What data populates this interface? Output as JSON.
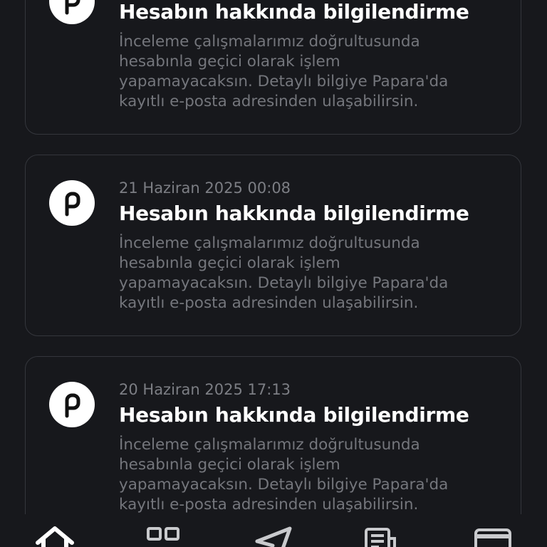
{
  "notifications": [
    {
      "date": "",
      "title": "Hesabın hakkında bilgilendirme",
      "body_lines": [
        "İnceleme çalışmalarımız doğrultusunda",
        "hesabınla geçici olarak işlem",
        "yapamayacaksın. Detaylı bilgiye Papara'da",
        "kayıtlı e-posta adresinden ulaşabilirsin."
      ],
      "icon": "papara-logo-icon"
    },
    {
      "date": "21 Haziran 2025 00:08",
      "title": "Hesabın hakkında bilgilendirme",
      "body_lines": [
        "İnceleme çalışmalarımız doğrultusunda",
        "hesabınla geçici olarak işlem",
        "yapamayacaksın. Detaylı bilgiye Papara'da",
        "kayıtlı e-posta adresinden ulaşabilirsin."
      ],
      "icon": "papara-logo-icon"
    },
    {
      "date": "20 Haziran 2025 17:13",
      "title": "Hesabın hakkında bilgilendirme",
      "body_lines": [
        "İnceleme çalışmalarımız doğrultusunda",
        "hesabınla geçici olarak işlem",
        "yapamayacaksın. Detaylı bilgiye Papara'da",
        "kayıtlı e-posta adresinden ulaşabilirsin."
      ],
      "icon": "papara-logo-icon"
    }
  ],
  "tab_bar": {
    "tabs": [
      {
        "icon": "home-icon"
      },
      {
        "icon": "grid-icon"
      },
      {
        "icon": "send-icon"
      },
      {
        "icon": "document-icon"
      },
      {
        "icon": "card-icon"
      }
    ]
  },
  "colors": {
    "background": "#17181c",
    "card_border": "#34363c",
    "title": "#ffffff",
    "date": "#7c7e84",
    "body": "#74767c"
  }
}
